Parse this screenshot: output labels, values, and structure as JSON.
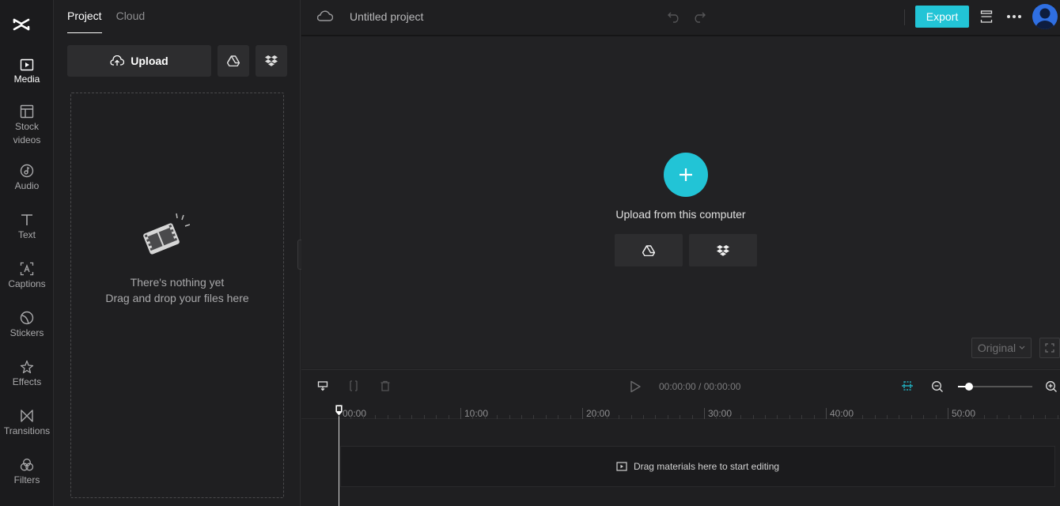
{
  "rail": {
    "items": [
      {
        "label": "Media",
        "icon": "media-icon",
        "active": true
      },
      {
        "label": "Stock\nvideos",
        "icon": "stock-videos-icon"
      },
      {
        "label": "Audio",
        "icon": "audio-icon"
      },
      {
        "label": "Text",
        "icon": "text-icon"
      },
      {
        "label": "Captions",
        "icon": "captions-icon"
      },
      {
        "label": "Stickers",
        "icon": "stickers-icon"
      },
      {
        "label": "Effects",
        "icon": "effects-icon"
      },
      {
        "label": "Transitions",
        "icon": "transitions-icon"
      },
      {
        "label": "Filters",
        "icon": "filters-icon"
      }
    ]
  },
  "panel": {
    "tabs": [
      "Project",
      "Cloud"
    ],
    "upload_label": "Upload",
    "empty_title": "There's nothing yet",
    "empty_hint": "Drag and drop your files here"
  },
  "topbar": {
    "project_title": "Untitled project",
    "export_label": "Export"
  },
  "player": {
    "upload_label": "Upload from this computer",
    "ratio_label": "Original"
  },
  "timeline": {
    "timecode_current": "00:00:00",
    "timecode_sep": " / ",
    "timecode_total": "00:00:00",
    "zoom_level": 0.15,
    "ticks": [
      "00:00",
      "10:00",
      "20:00",
      "30:00",
      "40:00",
      "50:00"
    ],
    "drop_hint": "Drag materials here to start editing"
  },
  "colors": {
    "accent": "#22c4d6",
    "background": "#1f1f21"
  }
}
